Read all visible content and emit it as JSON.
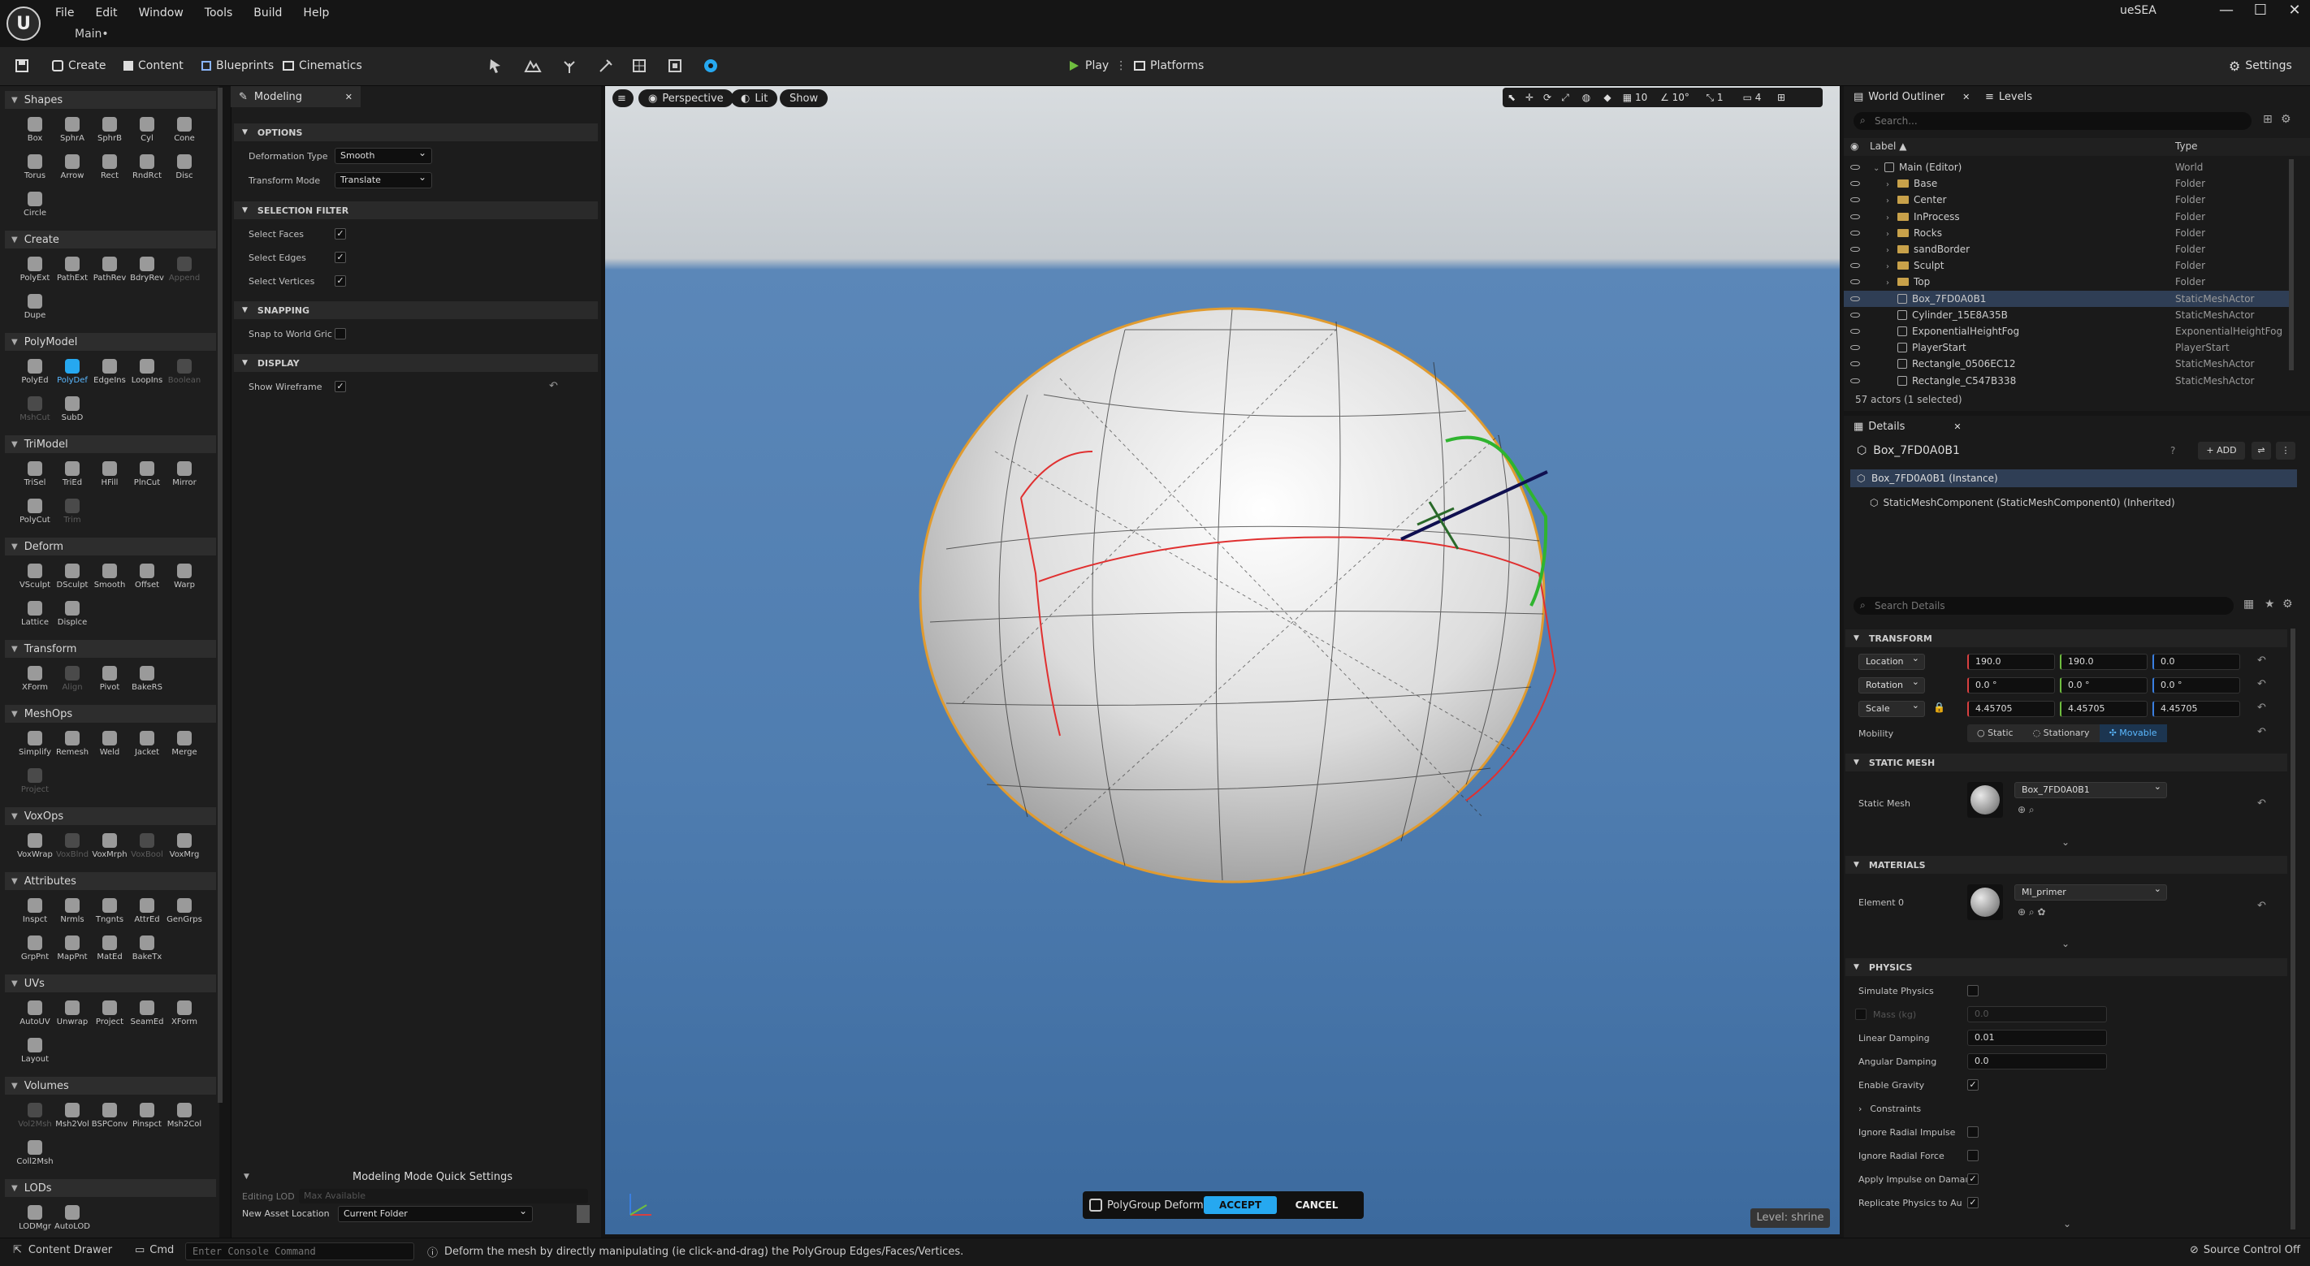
{
  "window": {
    "project_name": "ueSEA",
    "map_tab": "Main•",
    "controls": [
      "—",
      "☐",
      "✕"
    ]
  },
  "menu": [
    "File",
    "Edit",
    "Window",
    "Tools",
    "Build",
    "Help"
  ],
  "toolbar": {
    "create": "Create",
    "content": "Content",
    "blueprints": "Blueprints",
    "cinematics": "Cinematics",
    "play": "Play",
    "platforms": "Platforms",
    "settings": "Settings"
  },
  "palette": {
    "sections": [
      {
        "title": "Shapes",
        "tools": [
          {
            "l": "Box"
          },
          {
            "l": "SphrA"
          },
          {
            "l": "SphrB"
          },
          {
            "l": "Cyl"
          },
          {
            "l": "Cone"
          },
          {
            "l": "Torus"
          },
          {
            "l": "Arrow"
          },
          {
            "l": "Rect"
          },
          {
            "l": "RndRct"
          },
          {
            "l": "Disc"
          },
          {
            "l": "Circle"
          }
        ]
      },
      {
        "title": "Create",
        "tools": [
          {
            "l": "PolyExt"
          },
          {
            "l": "PathExt"
          },
          {
            "l": "PathRev"
          },
          {
            "l": "BdryRev"
          },
          {
            "l": "Append",
            "dim": true
          },
          {
            "l": "Dupe"
          }
        ]
      },
      {
        "title": "PolyModel",
        "tools": [
          {
            "l": "PolyEd"
          },
          {
            "l": "PolyDef",
            "sel": true
          },
          {
            "l": "EdgeIns"
          },
          {
            "l": "LoopIns"
          },
          {
            "l": "Boolean",
            "dim": true
          },
          {
            "l": "MshCut",
            "dim": true
          },
          {
            "l": "SubD"
          }
        ]
      },
      {
        "title": "TriModel",
        "tools": [
          {
            "l": "TriSel"
          },
          {
            "l": "TriEd"
          },
          {
            "l": "HFill"
          },
          {
            "l": "PlnCut"
          },
          {
            "l": "Mirror"
          },
          {
            "l": "PolyCut"
          },
          {
            "l": "Trim",
            "dim": true
          }
        ]
      },
      {
        "title": "Deform",
        "tools": [
          {
            "l": "VSculpt"
          },
          {
            "l": "DSculpt"
          },
          {
            "l": "Smooth"
          },
          {
            "l": "Offset"
          },
          {
            "l": "Warp"
          },
          {
            "l": "Lattice"
          },
          {
            "l": "Displce"
          }
        ]
      },
      {
        "title": "Transform",
        "tools": [
          {
            "l": "XForm"
          },
          {
            "l": "Align",
            "dim": true
          },
          {
            "l": "Pivot"
          },
          {
            "l": "BakeRS"
          }
        ]
      },
      {
        "title": "MeshOps",
        "tools": [
          {
            "l": "Simplify"
          },
          {
            "l": "Remesh"
          },
          {
            "l": "Weld"
          },
          {
            "l": "Jacket"
          },
          {
            "l": "Merge"
          },
          {
            "l": "Project",
            "dim": true
          }
        ]
      },
      {
        "title": "VoxOps",
        "tools": [
          {
            "l": "VoxWrap"
          },
          {
            "l": "VoxBlnd",
            "dim": true
          },
          {
            "l": "VoxMrph"
          },
          {
            "l": "VoxBool",
            "dim": true
          },
          {
            "l": "VoxMrg"
          }
        ]
      },
      {
        "title": "Attributes",
        "tools": [
          {
            "l": "Inspct"
          },
          {
            "l": "Nrmls"
          },
          {
            "l": "Tngnts"
          },
          {
            "l": "AttrEd"
          },
          {
            "l": "GenGrps"
          },
          {
            "l": "GrpPnt"
          },
          {
            "l": "MapPnt"
          },
          {
            "l": "MatEd"
          },
          {
            "l": "BakeTx"
          }
        ]
      },
      {
        "title": "UVs",
        "tools": [
          {
            "l": "AutoUV"
          },
          {
            "l": "Unwrap"
          },
          {
            "l": "Project"
          },
          {
            "l": "SeamEd"
          },
          {
            "l": "XForm"
          },
          {
            "l": "Layout"
          }
        ]
      },
      {
        "title": "Volumes",
        "tools": [
          {
            "l": "Vol2Msh",
            "dim": true
          },
          {
            "l": "Msh2Vol"
          },
          {
            "l": "BSPConv"
          },
          {
            "l": "Pinspct"
          },
          {
            "l": "Msh2Col"
          },
          {
            "l": "Coll2Msh"
          }
        ]
      },
      {
        "title": "LODs",
        "tools": [
          {
            "l": "LODMgr"
          },
          {
            "l": "AutoLOD"
          }
        ]
      }
    ]
  },
  "modeling": {
    "tab": "Modeling",
    "options": {
      "header": "OPTIONS",
      "deformation_label": "Deformation Type",
      "deformation_value": "Smooth",
      "transform_label": "Transform Mode",
      "transform_value": "Translate"
    },
    "selection": {
      "header": "SELECTION FILTER",
      "faces": "Select Faces",
      "edges": "Select Edges",
      "vertices": "Select Vertices"
    },
    "snapping": {
      "header": "SNAPPING",
      "snap": "Snap to World Gric"
    },
    "display": {
      "header": "DISPLAY",
      "wireframe": "Show Wireframe"
    },
    "quick": {
      "title": "Modeling Mode Quick Settings",
      "lod_label": "Editing LOD",
      "lod_value": "Max Available",
      "asset_label": "New Asset Location",
      "asset_value": "Current Folder"
    }
  },
  "viewport": {
    "perspective": "Perspective",
    "lit": "Lit",
    "show": "Show",
    "grid": "10",
    "angle": "10°",
    "scale": "1",
    "cam": "4",
    "level": "Level: shrine"
  },
  "polydeform": {
    "label": "PolyGroup Deform",
    "accept": "ACCEPT",
    "cancel": "CANCEL"
  },
  "outliner": {
    "tab": "World Outliner",
    "levels_tab": "Levels",
    "search_placeholder": "Search...",
    "col_label": "Label ▲",
    "col_type": "Type",
    "rows": [
      {
        "label": "Main (Editor)",
        "type": "World",
        "indent": 0,
        "kind": "world"
      },
      {
        "label": "Base",
        "type": "Folder",
        "indent": 1,
        "kind": "folder"
      },
      {
        "label": "Center",
        "type": "Folder",
        "indent": 1,
        "kind": "folder"
      },
      {
        "label": "InProcess",
        "type": "Folder",
        "indent": 1,
        "kind": "folder"
      },
      {
        "label": "Rocks",
        "type": "Folder",
        "indent": 1,
        "kind": "folder"
      },
      {
        "label": "sandBorder",
        "type": "Folder",
        "indent": 1,
        "kind": "folder"
      },
      {
        "label": "Sculpt",
        "type": "Folder",
        "indent": 1,
        "kind": "folder"
      },
      {
        "label": "Top",
        "type": "Folder",
        "indent": 1,
        "kind": "folder"
      },
      {
        "label": "Box_7FD0A0B1",
        "type": "StaticMeshActor",
        "indent": 1,
        "kind": "mesh",
        "sel": true
      },
      {
        "label": "Cylinder_15E8A35B",
        "type": "StaticMeshActor",
        "indent": 1,
        "kind": "mesh"
      },
      {
        "label": "ExponentialHeightFog",
        "type": "ExponentialHeightFog",
        "indent": 1,
        "kind": "mesh"
      },
      {
        "label": "PlayerStart",
        "type": "PlayerStart",
        "indent": 1,
        "kind": "mesh"
      },
      {
        "label": "Rectangle_0506EC12",
        "type": "StaticMeshActor",
        "indent": 1,
        "kind": "mesh"
      },
      {
        "label": "Rectangle_C547B338",
        "type": "StaticMeshActor",
        "indent": 1,
        "kind": "mesh"
      }
    ],
    "count": "57 actors (1 selected)"
  },
  "details": {
    "tab": "Details",
    "actor": "Box_7FD0A0B1",
    "add": "+ ADD",
    "instance": "Box_7FD0A0B1 (Instance)",
    "component": "StaticMeshComponent (StaticMeshComponent0) (Inherited)",
    "search_placeholder": "Search Details",
    "transform": {
      "header": "TRANSFORM",
      "location_label": "Location",
      "location": [
        "190.0",
        "190.0",
        "0.0"
      ],
      "rotation_label": "Rotation",
      "rotation": [
        "0.0 °",
        "0.0 °",
        "0.0 °"
      ],
      "scale_label": "Scale",
      "scale": [
        "4.45705",
        "4.45705",
        "4.45705"
      ],
      "mobility_label": "Mobility",
      "mobility": [
        "Static",
        "Stationary",
        "Movable"
      ]
    },
    "static_mesh": {
      "header": "STATIC MESH",
      "label": "Static Mesh",
      "value": "Box_7FD0A0B1"
    },
    "materials": {
      "header": "MATERIALS",
      "label": "Element 0",
      "value": "MI_primer"
    },
    "physics": {
      "header": "PHYSICS",
      "simulate": "Simulate Physics",
      "mass_label": "Mass (kg)",
      "mass": "0.0",
      "linear_label": "Linear Damping",
      "linear": "0.01",
      "angular_label": "Angular Damping",
      "angular": "0.0",
      "gravity": "Enable Gravity",
      "constraints": "Constraints",
      "radial_impulse": "Ignore Radial Impulse",
      "radial_force": "Ignore Radial Force",
      "apply_impulse": "Apply Impulse on Damaı",
      "replicate": "Replicate Physics to Au"
    }
  },
  "status": {
    "content_drawer": "Content Drawer",
    "cmd": "Cmd",
    "cmd_placeholder": "Enter Console Command",
    "message": "Deform the mesh by directly manipulating (ie click-and-drag) the PolyGroup Edges/Faces/Vertices.",
    "source": "Source Control Off"
  },
  "colors": {
    "accent": "#26a8f0",
    "selection": "#2f3e55",
    "x": "#d84040",
    "y": "#6fbe3f",
    "z": "#3a7fe0"
  }
}
